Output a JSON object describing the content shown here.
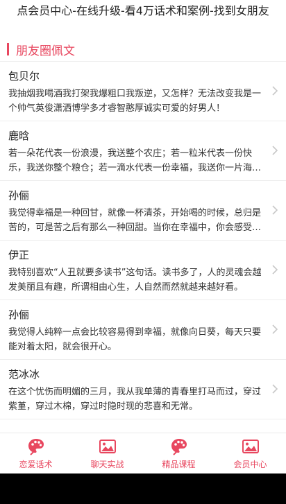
{
  "banner": {
    "text": "点会员中心-在线升级-看4万话术和案例-找到女朋友"
  },
  "section": {
    "title": "朋友圈佩文"
  },
  "items": [
    {
      "author": "包贝尔",
      "text": "我抽烟我喝酒我打架我爆粗口我叛逆，又怎样？无法改变我是一个帅气英俊潇洒博学多才睿智憨厚诚实可爱的好男人！"
    },
    {
      "author": "鹿晗",
      "text": "若一朵花代表一份浪漫，我送整个农庄；若一粒米代表一份快乐，我送你整个粮仓；若一滴水代表一份幸福，我送你一片海洋。"
    },
    {
      "author": "孙俪",
      "text": "我觉得幸福是一种回甘，就像一杯清茶，开始喝的时候，总归是苦的，可是苦之后有那么一种回甜。当你在幸福中，你会感受到。"
    },
    {
      "author": "伊正",
      "text": "我特别喜欢“人丑就要多读书”这句话。读书多了，人的灵魂会越发美丽且有趣，所谓相由心生，人自然而然就越来越好看。"
    },
    {
      "author": "孙俪",
      "text": "我觉得人纯粹一点会比较容易得到幸福，就像向日葵，每天只要能对着太阳，就会很开心。"
    },
    {
      "author": "范冰冰",
      "text": "在这个忧伤而明媚的三月，我从我单薄的青春里打马而过，穿过紫堇，穿过木棉，穿过时隐时现的悲喜和无常。"
    }
  ],
  "tabs": [
    {
      "label": "恋爱话术",
      "icon": "palette-icon"
    },
    {
      "label": "聊天实战",
      "icon": "image-icon"
    },
    {
      "label": "精品课程",
      "icon": "palette-icon"
    },
    {
      "label": "会员中心",
      "icon": "image-icon"
    }
  ],
  "colors": {
    "accent": "#e8475f",
    "text": "#222222",
    "divider": "#ededed"
  }
}
